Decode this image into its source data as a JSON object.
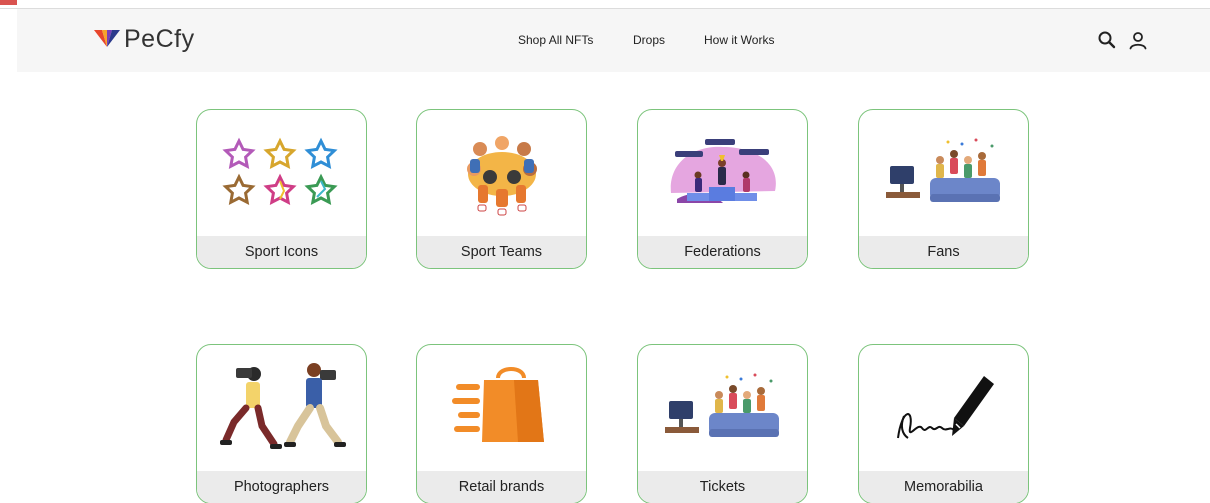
{
  "brand": {
    "name": "PeCfy"
  },
  "nav": {
    "links": [
      {
        "label": "Shop All NFTs"
      },
      {
        "label": "Drops"
      },
      {
        "label": "How it Works"
      }
    ],
    "icons": [
      "search-icon",
      "user-icon"
    ]
  },
  "categories": [
    {
      "label": "Sport Icons",
      "icon": "stars-illustration"
    },
    {
      "label": "Sport Teams",
      "icon": "team-huddle-illustration"
    },
    {
      "label": "Federations",
      "icon": "podium-illustration"
    },
    {
      "label": "Fans",
      "icon": "fans-sofa-illustration"
    },
    {
      "label": "Photographers",
      "icon": "photographers-illustration"
    },
    {
      "label": "Retail brands",
      "icon": "shopping-bag-illustration"
    },
    {
      "label": "Tickets",
      "icon": "fans-sofa-illustration"
    },
    {
      "label": "Memorabilia",
      "icon": "pen-signature-illustration"
    }
  ],
  "colors": {
    "card_border": "#7cc47c",
    "label_bar": "#ebebeb",
    "navbar_bg": "#f6f6f6",
    "bag_orange": "#f28c28"
  }
}
